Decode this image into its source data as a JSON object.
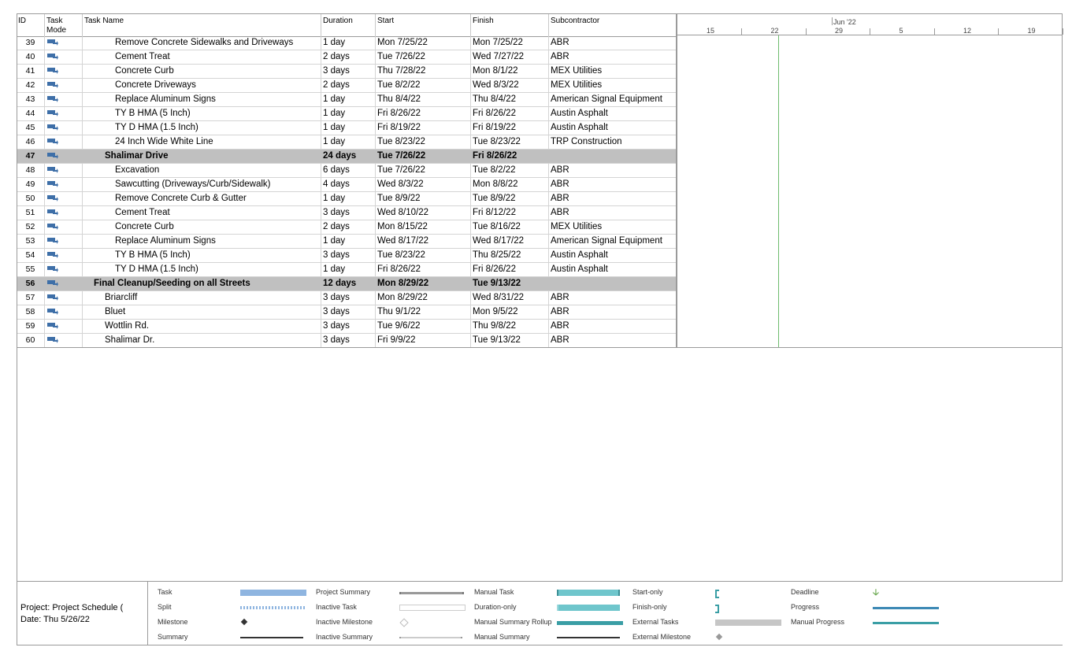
{
  "columns": {
    "id": "ID",
    "task_mode_line1": "Task",
    "task_mode_line2": "Mode",
    "task_name": "Task Name",
    "duration": "Duration",
    "start": "Start",
    "finish": "Finish",
    "subcontractor": "Subcontractor"
  },
  "timescale": {
    "month_label": "Jun '22",
    "days": [
      "15",
      "22",
      "29",
      "5",
      "12",
      "19"
    ]
  },
  "rows": [
    {
      "id": "39",
      "name": "Remove Concrete Sidewalks and Driveways",
      "duration": "1 day",
      "start": "Mon 7/25/22",
      "finish": "Mon 7/25/22",
      "sub": "ABR",
      "level": 3,
      "summary": false
    },
    {
      "id": "40",
      "name": "Cement Treat",
      "duration": "2 days",
      "start": "Tue 7/26/22",
      "finish": "Wed 7/27/22",
      "sub": "ABR",
      "level": 3,
      "summary": false
    },
    {
      "id": "41",
      "name": "Concrete Curb",
      "duration": "3 days",
      "start": "Thu 7/28/22",
      "finish": "Mon 8/1/22",
      "sub": "MEX Utilities",
      "level": 3,
      "summary": false
    },
    {
      "id": "42",
      "name": "Concrete Driveways",
      "duration": "2 days",
      "start": "Tue 8/2/22",
      "finish": "Wed 8/3/22",
      "sub": "MEX Utilities",
      "level": 3,
      "summary": false
    },
    {
      "id": "43",
      "name": "Replace Aluminum Signs",
      "duration": "1 day",
      "start": "Thu 8/4/22",
      "finish": "Thu 8/4/22",
      "sub": "American Signal Equipment",
      "level": 3,
      "summary": false
    },
    {
      "id": "44",
      "name": "TY B HMA (5 Inch)",
      "duration": "1 day",
      "start": "Fri 8/26/22",
      "finish": "Fri 8/26/22",
      "sub": "Austin Asphalt",
      "level": 3,
      "summary": false
    },
    {
      "id": "45",
      "name": "TY D HMA (1.5 Inch)",
      "duration": "1 day",
      "start": "Fri 8/19/22",
      "finish": "Fri 8/19/22",
      "sub": "Austin Asphalt",
      "level": 3,
      "summary": false
    },
    {
      "id": "46",
      "name": "24 Inch Wide White Line",
      "duration": "1 day",
      "start": "Tue 8/23/22",
      "finish": "Tue 8/23/22",
      "sub": "TRP Construction",
      "level": 3,
      "summary": false
    },
    {
      "id": "47",
      "name": "Shalimar Drive",
      "duration": "24 days",
      "start": "Tue 7/26/22",
      "finish": "Fri 8/26/22",
      "sub": "",
      "level": 2,
      "summary": true
    },
    {
      "id": "48",
      "name": "Excavation",
      "duration": "6 days",
      "start": "Tue 7/26/22",
      "finish": "Tue 8/2/22",
      "sub": "ABR",
      "level": 3,
      "summary": false
    },
    {
      "id": "49",
      "name": "Sawcutting (Driveways/Curb/Sidewalk)",
      "duration": "4 days",
      "start": "Wed 8/3/22",
      "finish": "Mon 8/8/22",
      "sub": "ABR",
      "level": 3,
      "summary": false
    },
    {
      "id": "50",
      "name": "Remove Concrete Curb & Gutter",
      "duration": "1 day",
      "start": "Tue 8/9/22",
      "finish": "Tue 8/9/22",
      "sub": "ABR",
      "level": 3,
      "summary": false
    },
    {
      "id": "51",
      "name": "Cement Treat",
      "duration": "3 days",
      "start": "Wed 8/10/22",
      "finish": "Fri 8/12/22",
      "sub": "ABR",
      "level": 3,
      "summary": false
    },
    {
      "id": "52",
      "name": "Concrete Curb",
      "duration": "2 days",
      "start": "Mon 8/15/22",
      "finish": "Tue 8/16/22",
      "sub": "MEX Utilities",
      "level": 3,
      "summary": false
    },
    {
      "id": "53",
      "name": "Replace Aluminum Signs",
      "duration": "1 day",
      "start": "Wed 8/17/22",
      "finish": "Wed 8/17/22",
      "sub": "American Signal Equipment",
      "level": 3,
      "summary": false
    },
    {
      "id": "54",
      "name": "TY B HMA (5 Inch)",
      "duration": "3 days",
      "start": "Tue 8/23/22",
      "finish": "Thu 8/25/22",
      "sub": "Austin Asphalt",
      "level": 3,
      "summary": false
    },
    {
      "id": "55",
      "name": "TY D HMA (1.5 Inch)",
      "duration": "1 day",
      "start": "Fri 8/26/22",
      "finish": "Fri 8/26/22",
      "sub": "Austin Asphalt",
      "level": 3,
      "summary": false
    },
    {
      "id": "56",
      "name": "Final Cleanup/Seeding on all Streets",
      "duration": "12 days",
      "start": "Mon 8/29/22",
      "finish": "Tue 9/13/22",
      "sub": "",
      "level": 1,
      "summary": true
    },
    {
      "id": "57",
      "name": "Briarcliff",
      "duration": "3 days",
      "start": "Mon 8/29/22",
      "finish": "Wed 8/31/22",
      "sub": "ABR",
      "level": 2,
      "summary": false
    },
    {
      "id": "58",
      "name": "Bluet",
      "duration": "3 days",
      "start": "Thu 9/1/22",
      "finish": "Mon 9/5/22",
      "sub": "ABR",
      "level": 2,
      "summary": false
    },
    {
      "id": "59",
      "name": "Wottlin Rd.",
      "duration": "3 days",
      "start": "Tue 9/6/22",
      "finish": "Thu 9/8/22",
      "sub": "ABR",
      "level": 2,
      "summary": false
    },
    {
      "id": "60",
      "name": "Shalimar Dr.",
      "duration": "3 days",
      "start": "Fri 9/9/22",
      "finish": "Tue 9/13/22",
      "sub": "ABR",
      "level": 2,
      "summary": false
    }
  ],
  "legend": {
    "project_line": "Project: Project Schedule (",
    "date_line": "Date: Thu 5/26/22",
    "items": [
      {
        "label": "Task",
        "symbol": "task-bar-icon"
      },
      {
        "label": "Split",
        "symbol": "split-icon"
      },
      {
        "label": "Milestone",
        "symbol": "milestone-icon"
      },
      {
        "label": "Summary",
        "symbol": "summary-bar-icon"
      },
      {
        "label": "Project Summary",
        "symbol": "project-summary-icon"
      },
      {
        "label": "Inactive Task",
        "symbol": "inactive-task-icon"
      },
      {
        "label": "Inactive Milestone",
        "symbol": "inactive-milestone-icon"
      },
      {
        "label": "Inactive Summary",
        "symbol": "inactive-summary-icon"
      },
      {
        "label": "Manual Task",
        "symbol": "manual-task-icon"
      },
      {
        "label": "Duration-only",
        "symbol": "duration-only-icon"
      },
      {
        "label": "Manual Summary Rollup",
        "symbol": "manual-summary-rollup-icon"
      },
      {
        "label": "Manual Summary",
        "symbol": "manual-summary-icon"
      },
      {
        "label": "Start-only",
        "symbol": "start-only-icon"
      },
      {
        "label": "Finish-only",
        "symbol": "finish-only-icon"
      },
      {
        "label": "External Tasks",
        "symbol": "external-tasks-icon"
      },
      {
        "label": "External Milestone",
        "symbol": "external-milestone-icon"
      },
      {
        "label": "Deadline",
        "symbol": "deadline-arrow-icon"
      },
      {
        "label": "Progress",
        "symbol": "progress-line-icon"
      },
      {
        "label": "Manual Progress",
        "symbol": "manual-progress-line-icon"
      }
    ]
  },
  "colors": {
    "summary_row_bg": "#c0c0c0",
    "task_bar": "#8fb5e0",
    "manual_task": "#6fc6cc",
    "progress": "#3d89b5",
    "deadline": "#6aa84f",
    "today_line": "#6dbb6d"
  }
}
